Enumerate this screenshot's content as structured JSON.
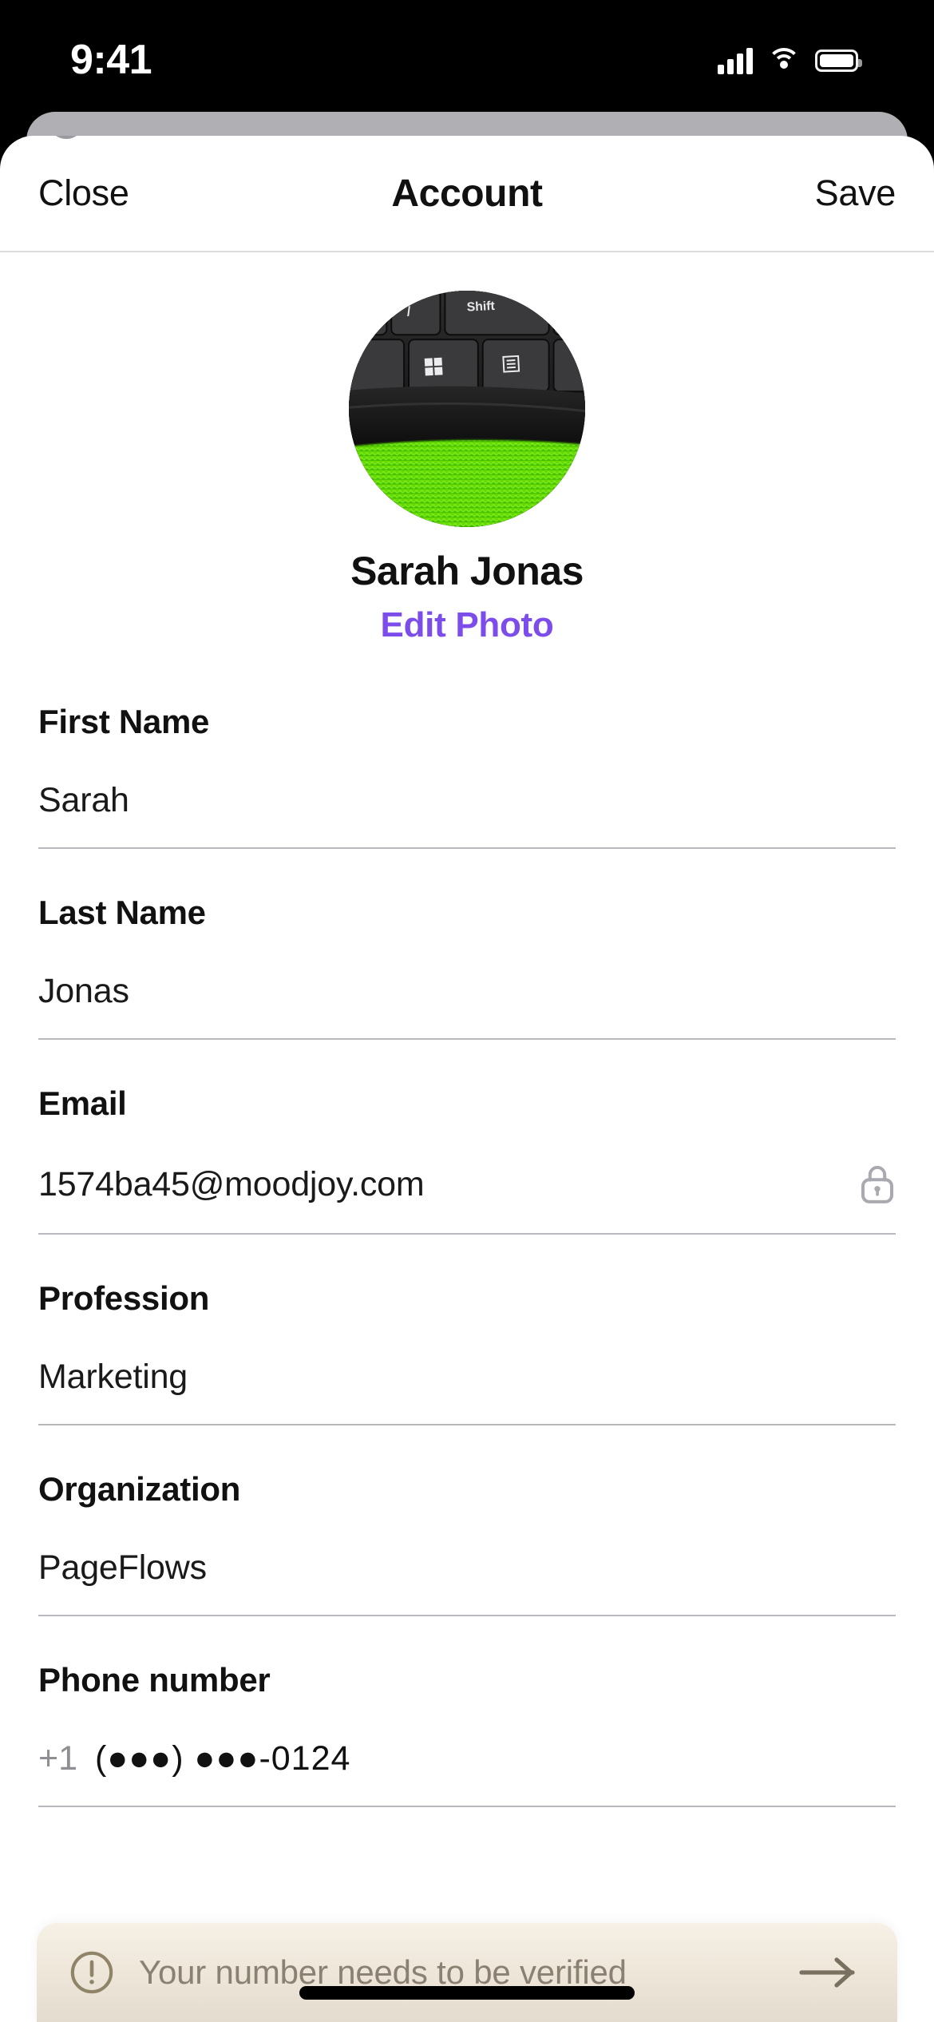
{
  "status_bar": {
    "time": "9:41",
    "signal_icon": "cellular-signal-icon",
    "wifi_icon": "wifi-icon",
    "battery_icon": "battery-full-icon"
  },
  "header": {
    "close_label": "Close",
    "title": "Account",
    "save_label": "Save"
  },
  "profile": {
    "avatar_alt": "keyboard on green microfiber cloth",
    "name": "Sarah Jonas",
    "edit_photo_label": "Edit Photo"
  },
  "form": {
    "fields": [
      {
        "label": "First Name",
        "value": "Sarah",
        "icon": null
      },
      {
        "label": "Last Name",
        "value": "Jonas",
        "icon": null
      },
      {
        "label": "Email",
        "value": "1574ba45@moodjoy.com",
        "icon": "lock-icon"
      },
      {
        "label": "Profession",
        "value": "Marketing",
        "icon": null
      },
      {
        "label": "Organization",
        "value": "PageFlows",
        "icon": null
      }
    ],
    "phone": {
      "label": "Phone number",
      "country_code": "+1",
      "number": "(●●●) ●●●-0124"
    }
  },
  "banner": {
    "icon": "warning-circle-icon",
    "text": "Your number needs to be verified",
    "arrow_icon": "arrow-right-icon"
  },
  "colors": {
    "accent_purple": "#7C4DEB",
    "text_primary": "#111111",
    "text_muted": "#8E8E93",
    "separator": "#B9B9BD",
    "banner_bg": "#EFE8DA",
    "banner_text": "#8A8173"
  }
}
